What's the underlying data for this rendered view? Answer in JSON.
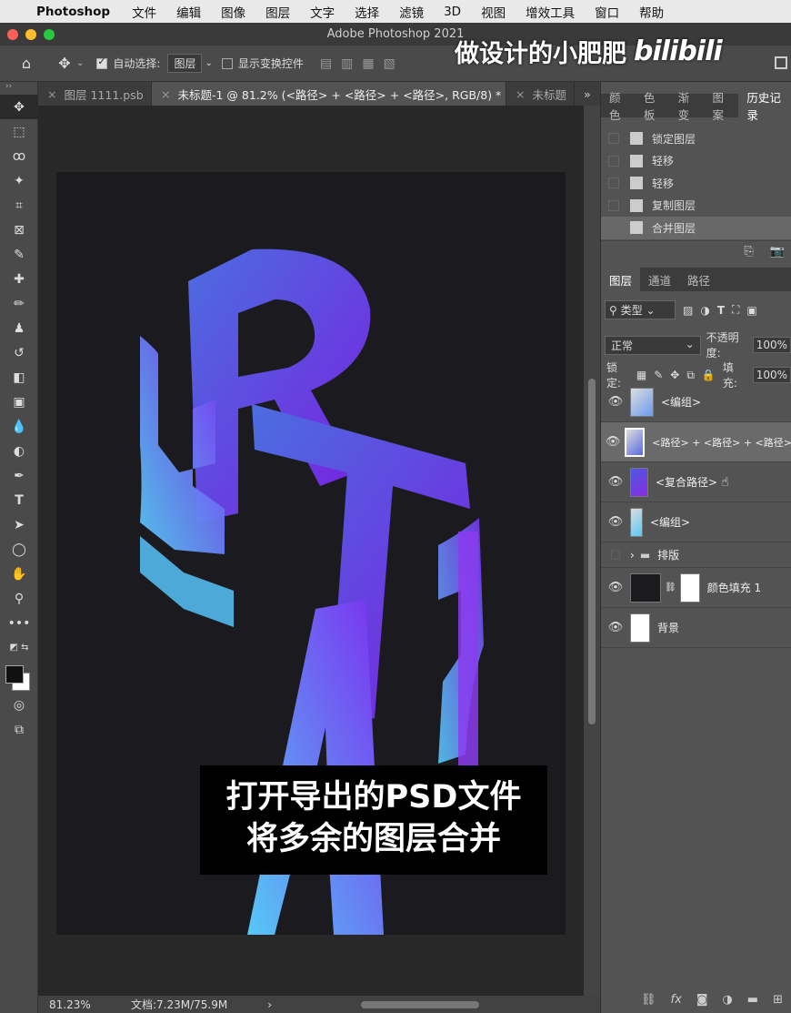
{
  "menubar": {
    "apple": "",
    "app": "Photoshop",
    "items": [
      "文件",
      "编辑",
      "图像",
      "图层",
      "文字",
      "选择",
      "滤镜",
      "3D",
      "视图",
      "增效工具",
      "窗口",
      "帮助"
    ]
  },
  "window": {
    "title": "Adobe Photoshop 2021"
  },
  "watermark": {
    "text": "做设计的小肥肥",
    "brand": "bilibili"
  },
  "options": {
    "auto_select": "自动选择:",
    "auto_select_value": "图层",
    "show_transform": "显示变换控件"
  },
  "tabs": [
    {
      "label": "图层 1111.psb"
    },
    {
      "label": "未标题-1 @ 81.2% (<路径> + <路径> + <路径>, RGB/8) *"
    },
    {
      "label": "未标题"
    }
  ],
  "canvas": {
    "subtitle_line1": "打开导出的PSD文件",
    "subtitle_line2": "将多余的图层合并",
    "gradient_start": "#56c8f5",
    "gradient_end": "#7b2ff0"
  },
  "status": {
    "zoom": "81.23%",
    "doc": "文档:7.23M/75.9M",
    "arrow": "›"
  },
  "panel_top": {
    "tabs": [
      "颜色",
      "色板",
      "渐变",
      "图案",
      "历史记录"
    ]
  },
  "history": [
    "锁定图层",
    "轻移",
    "轻移",
    "复制图层",
    "合并图层"
  ],
  "layers_panel": {
    "tabs": [
      "图层",
      "通道",
      "路径"
    ],
    "filter": "类型",
    "blend": "正常",
    "opacity_label": "不透明度:",
    "opacity": "100%",
    "lock_label": "锁定:",
    "fill_label": "填充:",
    "fill": "100%",
    "layers": [
      {
        "name": "<编组>"
      },
      {
        "name": "<路径> + <路径> + <路径>"
      },
      {
        "name": "<复合路径>"
      },
      {
        "name": "<编组>"
      },
      {
        "name": "排版"
      },
      {
        "name": "颜色填充 1"
      },
      {
        "name": "背景"
      }
    ]
  }
}
